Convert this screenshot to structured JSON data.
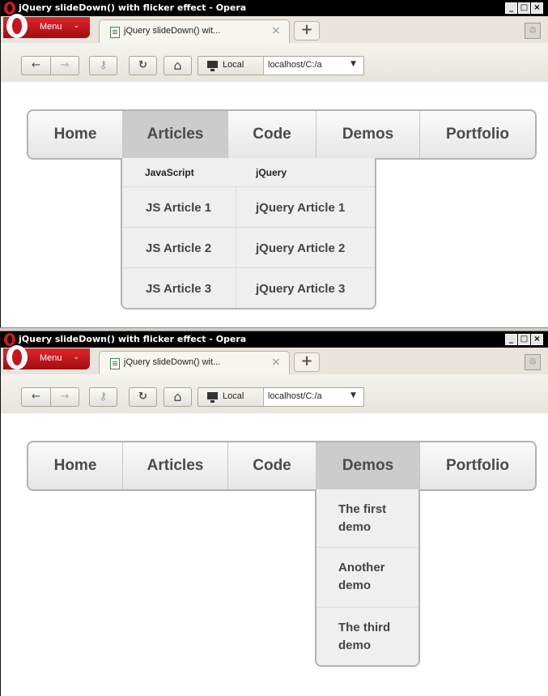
{
  "window": {
    "title": "jQuery slideDown() with flicker effect - Opera",
    "min_label": "_",
    "max_label": "□",
    "close_label": "×"
  },
  "browser": {
    "menu_label": "Menu",
    "menu_chevron": "⌄",
    "tab_title": "jQuery slideDown() wit...",
    "tab_close": "×",
    "new_tab": "+",
    "trash": "♲",
    "back": "←",
    "forward": "→",
    "key": "⚷",
    "reload": "↻",
    "home": "⌂",
    "local_label": "Local",
    "url": "localhost/C:/a",
    "url_dropdown": "▼"
  },
  "nav": {
    "items": [
      "Home",
      "Articles",
      "Code",
      "Demos",
      "Portfolio"
    ]
  },
  "top_view": {
    "active": "Articles",
    "dropdown": {
      "headers": [
        "JavaScript",
        "jQuery"
      ],
      "rows": [
        [
          "JS Article 1",
          "jQuery Article 1"
        ],
        [
          "JS Article 2",
          "jQuery Article 2"
        ],
        [
          "JS Article 3",
          "jQuery Article 3"
        ]
      ]
    }
  },
  "bottom_view": {
    "active": "Demos",
    "dropdown": {
      "items": [
        [
          "The first",
          "demo"
        ],
        [
          "Another",
          "demo"
        ],
        [
          "The third",
          "demo"
        ]
      ]
    }
  },
  "colors": {
    "titlebar": "#000000",
    "menu_button": "#c8151c",
    "active_tab": "#cccccc",
    "dropdown_bg": "#efefef"
  }
}
